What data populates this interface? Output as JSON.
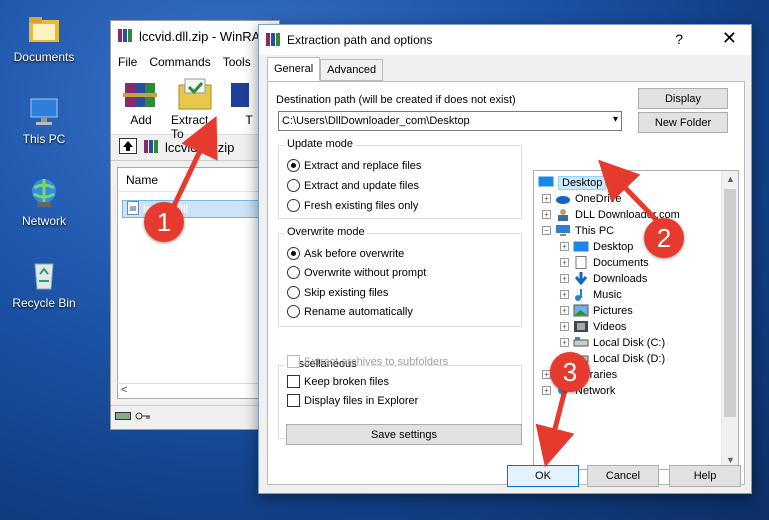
{
  "desktop": {
    "icons": [
      {
        "label": "Documents"
      },
      {
        "label": "This PC"
      },
      {
        "label": "Network"
      },
      {
        "label": "Recycle Bin"
      }
    ]
  },
  "winrar": {
    "title": "lccvid.dll.zip - WinRAR",
    "menu": [
      "File",
      "Commands",
      "Tools"
    ],
    "toolbar": [
      "Add",
      "Extract To",
      "T"
    ],
    "path": "lccvid.dll.zip",
    "column_name": "Name",
    "file_row": "lccvid.dll",
    "scroll_left": "<"
  },
  "dialog": {
    "title": "Extraction path and options",
    "help_glyph": "?",
    "close_glyph": "✕",
    "tabs": [
      "General",
      "Advanced"
    ],
    "dest_label": "Destination path (will be created if does not exist)",
    "dest_value": "C:\\Users\\DllDownloader_com\\Desktop",
    "display_button": "Display",
    "new_folder_button": "New Folder",
    "update_mode": {
      "title": "Update mode",
      "options": [
        "Extract and replace files",
        "Extract and update files",
        "Fresh existing files only"
      ],
      "selected": 0
    },
    "overwrite_mode": {
      "title": "Overwrite mode",
      "options": [
        "Ask before overwrite",
        "Overwrite without prompt",
        "Skip existing files",
        "Rename automatically"
      ],
      "selected": 0
    },
    "misc": {
      "title": "Miscellaneous",
      "options": [
        "Extract archives to subfolders",
        "Keep broken files",
        "Display files in Explorer"
      ]
    },
    "save_settings": "Save settings",
    "tree": {
      "root": "Desktop",
      "level1": [
        "OneDrive",
        "DLL Downloader.com",
        "This PC"
      ],
      "thispc": [
        "Desktop",
        "Documents",
        "Downloads",
        "Music",
        "Pictures",
        "Videos",
        "Local Disk (C:)",
        "Local Disk (D:)"
      ],
      "bottom": [
        "Libraries",
        "Network"
      ]
    },
    "ok": "OK",
    "cancel": "Cancel",
    "help": "Help"
  },
  "annotations": [
    "1",
    "2",
    "3"
  ],
  "colors": {
    "arrow": "#e63a2e",
    "selection": "#cce8ff",
    "accent": "#0078d7"
  }
}
